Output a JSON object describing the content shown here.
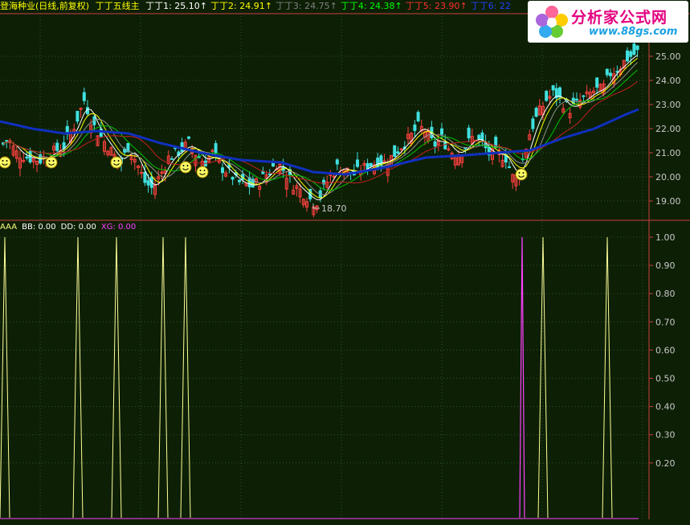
{
  "header": {
    "stock_title": "登海种业(日线,前复权)",
    "indicator_name": "丁丁五线主",
    "lines": [
      {
        "label": "丁丁1:",
        "value": "25.10",
        "arrow": "↑",
        "color": "#ffffff"
      },
      {
        "label": "丁丁2:",
        "value": "24.91",
        "arrow": "↑",
        "color": "#ffff00"
      },
      {
        "label": "丁丁3:",
        "value": "24.75",
        "arrow": "↑",
        "color": "#808080"
      },
      {
        "label": "丁丁4:",
        "value": "24.38",
        "arrow": "↑",
        "color": "#00ff00"
      },
      {
        "label": "丁丁5:",
        "value": "23.90",
        "arrow": "↑",
        "color": "#ff3030"
      },
      {
        "label": "丁丁6:",
        "value": "22",
        "arrow": "",
        "color": "#2040ff"
      }
    ]
  },
  "indicator_header": {
    "items": [
      {
        "label": "AAA",
        "value": "",
        "color": "#ffff80"
      },
      {
        "label": "BB:",
        "value": "0.00",
        "color": "#ffffff"
      },
      {
        "label": "DD:",
        "value": "0.00",
        "color": "#ffffff"
      },
      {
        "label": "XG:",
        "value": "0.00",
        "color": "#ff40ff"
      }
    ]
  },
  "logo": {
    "text": "分析家公式网",
    "url_text": "www.88gs.com"
  },
  "colors": {
    "up": "#ff4040",
    "down": "#40e0e0",
    "ma_blue": "#1030c0",
    "grid": "#2a5a2a",
    "axis": "#c84040",
    "axis_label": "#c8c8c8",
    "aaa_line": "#ffff99",
    "xg_line": "#ff40ff",
    "background": "#0d1f05"
  },
  "chart_data": [
    {
      "type": "candlestick",
      "title": "",
      "y_ticks": [
        "25.00",
        "24.00",
        "23.00",
        "22.00",
        "21.00",
        "20.00",
        "19.00"
      ],
      "ylim": [
        18.4,
        26.4
      ],
      "low_annotation": "18.70",
      "price_path": [
        [
          0,
          21.2
        ],
        [
          10,
          21.6
        ],
        [
          20,
          21.0
        ],
        [
          35,
          20.8
        ],
        [
          50,
          20.7
        ],
        [
          65,
          21.0
        ],
        [
          80,
          21.3
        ],
        [
          95,
          22.3
        ],
        [
          105,
          23.2
        ],
        [
          115,
          22.2
        ],
        [
          125,
          21.7
        ],
        [
          140,
          21.0
        ],
        [
          150,
          20.5
        ],
        [
          160,
          21.3
        ],
        [
          170,
          20.6
        ],
        [
          180,
          19.8
        ],
        [
          190,
          19.5
        ],
        [
          200,
          20.1
        ],
        [
          210,
          20.8
        ],
        [
          225,
          21.1
        ],
        [
          235,
          21.4
        ],
        [
          245,
          20.9
        ],
        [
          255,
          20.6
        ],
        [
          265,
          21.0
        ],
        [
          275,
          20.4
        ],
        [
          285,
          20.2
        ],
        [
          295,
          19.8
        ],
        [
          305,
          19.7
        ],
        [
          315,
          19.6
        ],
        [
          325,
          19.9
        ],
        [
          335,
          20.2
        ],
        [
          345,
          20.6
        ],
        [
          355,
          20.2
        ],
        [
          365,
          19.7
        ],
        [
          375,
          19.4
        ],
        [
          385,
          19.1
        ],
        [
          393,
          18.9
        ],
        [
          400,
          19.3
        ],
        [
          410,
          20.0
        ],
        [
          420,
          20.4
        ],
        [
          430,
          20.3
        ],
        [
          440,
          20.1
        ],
        [
          450,
          20.3
        ],
        [
          460,
          20.5
        ],
        [
          470,
          20.6
        ],
        [
          480,
          20.6
        ],
        [
          490,
          20.9
        ],
        [
          500,
          21.3
        ],
        [
          510,
          21.6
        ],
        [
          520,
          22.1
        ],
        [
          530,
          21.9
        ],
        [
          540,
          21.3
        ],
        [
          550,
          21.6
        ],
        [
          560,
          21.1
        ],
        [
          570,
          20.9
        ],
        [
          580,
          21.3
        ],
        [
          590,
          21.7
        ],
        [
          600,
          21.4
        ],
        [
          610,
          20.9
        ],
        [
          620,
          21.0
        ],
        [
          630,
          20.8
        ],
        [
          640,
          19.8
        ],
        [
          650,
          20.6
        ],
        [
          660,
          21.9
        ],
        [
          670,
          22.6
        ],
        [
          680,
          23.2
        ],
        [
          690,
          23.5
        ],
        [
          700,
          23.1
        ],
        [
          710,
          22.8
        ],
        [
          720,
          23.1
        ],
        [
          730,
          23.3
        ],
        [
          740,
          23.6
        ],
        [
          750,
          23.6
        ],
        [
          760,
          24.3
        ],
        [
          770,
          24.5
        ],
        [
          780,
          24.9
        ],
        [
          790,
          25.1
        ],
        [
          795,
          25.2
        ]
      ],
      "ma_series": [
        {
          "name": "丁丁1",
          "color": "#ffffff",
          "lag": 3
        },
        {
          "name": "丁丁2",
          "color": "#ffff00",
          "lag": 5
        },
        {
          "name": "丁丁3",
          "color": "#909090",
          "lag": 8
        },
        {
          "name": "丁丁4",
          "color": "#00c000",
          "lag": 12
        },
        {
          "name": "丁丁5",
          "color": "#c02020",
          "lag": 20
        }
      ],
      "long_ma": {
        "name": "丁丁6",
        "points": [
          [
            0,
            22.3
          ],
          [
            40,
            22.0
          ],
          [
            80,
            21.8
          ],
          [
            120,
            21.9
          ],
          [
            160,
            21.8
          ],
          [
            200,
            21.4
          ],
          [
            250,
            21.0
          ],
          [
            300,
            20.7
          ],
          [
            350,
            20.6
          ],
          [
            390,
            20.2
          ],
          [
            430,
            20.1
          ],
          [
            480,
            20.4
          ],
          [
            530,
            20.8
          ],
          [
            580,
            20.9
          ],
          [
            620,
            21.0
          ],
          [
            660,
            21.1
          ],
          [
            700,
            21.6
          ],
          [
            740,
            22.0
          ],
          [
            780,
            22.6
          ],
          [
            795,
            22.8
          ]
        ]
      },
      "smiley_markers": [
        {
          "x": 6,
          "price": 20.6
        },
        {
          "x": 64,
          "price": 20.6
        },
        {
          "x": 145,
          "price": 20.6
        },
        {
          "x": 231,
          "price": 20.4
        },
        {
          "x": 252,
          "price": 20.2
        },
        {
          "x": 649,
          "price": 20.1
        }
      ]
    },
    {
      "type": "line",
      "title": "",
      "y_ticks": [
        "1.00",
        "0.90",
        "0.80",
        "0.70",
        "0.60",
        "0.50",
        "0.40",
        "0.30",
        "0.20"
      ],
      "ylim": [
        0,
        1
      ],
      "aaa_spikes": [
        6,
        97,
        145,
        203,
        231,
        676,
        756
      ],
      "xg_spikes": [
        650
      ]
    }
  ]
}
